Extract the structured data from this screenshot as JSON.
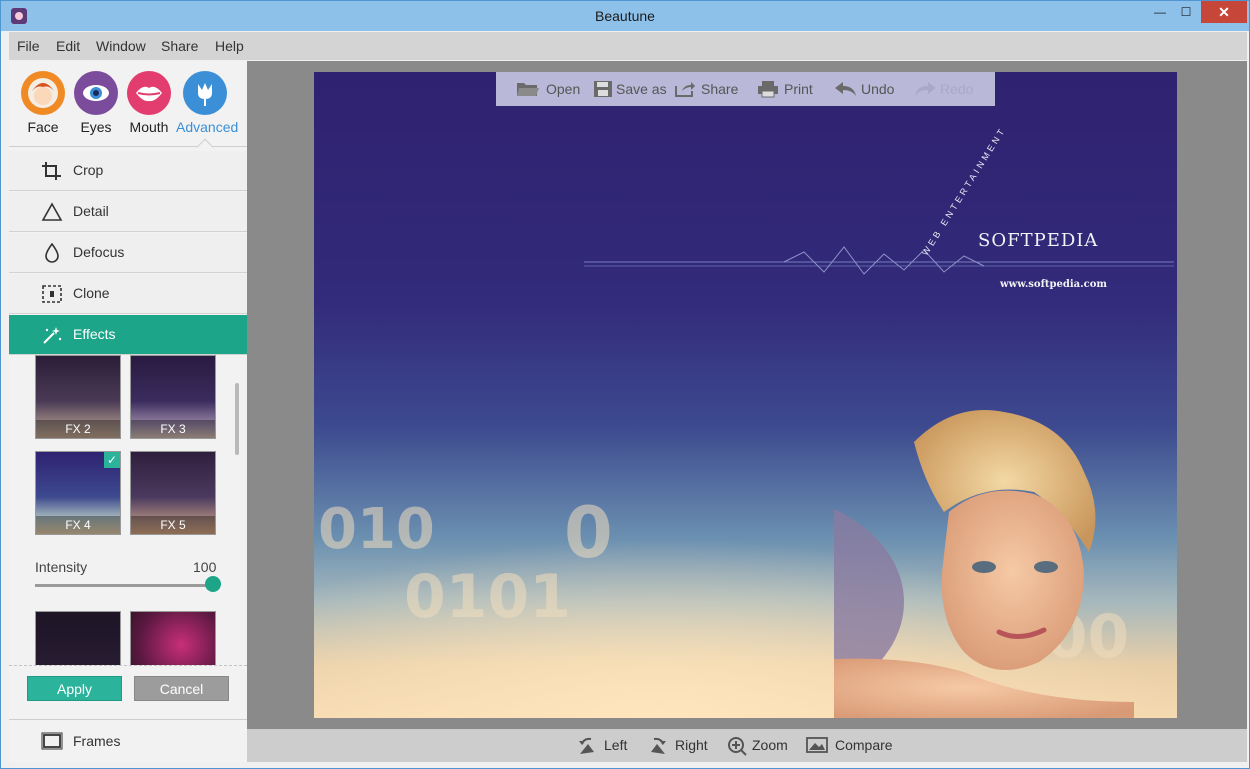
{
  "window": {
    "title": "Beautune",
    "minimize": "—",
    "maximize": "☐",
    "close": "✕"
  },
  "menu": [
    "File",
    "Edit",
    "Window",
    "Share",
    "Help"
  ],
  "categories": [
    {
      "label": "Face",
      "icon": "face-icon",
      "color": "#f08a24"
    },
    {
      "label": "Eyes",
      "icon": "eye-icon",
      "color": "#7b4c9c"
    },
    {
      "label": "Mouth",
      "icon": "mouth-icon",
      "color": "#e23d6e"
    },
    {
      "label": "Advanced",
      "icon": "flower-icon",
      "color": "#3a8fd6",
      "active": true
    }
  ],
  "tools": [
    {
      "label": "Crop",
      "icon": "crop-icon"
    },
    {
      "label": "Detail",
      "icon": "triangle-icon"
    },
    {
      "label": "Defocus",
      "icon": "droplet-icon"
    },
    {
      "label": "Clone",
      "icon": "clone-icon"
    },
    {
      "label": "Effects",
      "icon": "magic-wand-icon",
      "active": true
    }
  ],
  "effects": [
    {
      "label": "FX 2"
    },
    {
      "label": "FX 3"
    },
    {
      "label": "FX 4",
      "selected": true
    },
    {
      "label": "FX 5"
    }
  ],
  "intensity": {
    "label": "Intensity",
    "value": "100",
    "fraction": 1.0
  },
  "buttons": {
    "apply": "Apply",
    "cancel": "Cancel"
  },
  "frames": {
    "label": "Frames",
    "icon": "frame-icon"
  },
  "photo_toolbar": [
    {
      "label": "Open",
      "icon": "folder-icon"
    },
    {
      "label": "Save as",
      "icon": "save-icon"
    },
    {
      "label": "Share",
      "icon": "share-icon"
    },
    {
      "label": "Print",
      "icon": "printer-icon"
    },
    {
      "label": "Undo",
      "icon": "undo-icon"
    },
    {
      "label": "Redo",
      "icon": "redo-icon",
      "disabled": true
    }
  ],
  "photo": {
    "brand": "SOFTPEDIA",
    "url": "www.softpedia.com",
    "tagline": "WEB ENTERTAINMENT"
  },
  "bottom_bar": [
    {
      "label": "Left",
      "icon": "rotate-left-icon"
    },
    {
      "label": "Right",
      "icon": "rotate-right-icon"
    },
    {
      "label": "Zoom",
      "icon": "zoom-icon"
    },
    {
      "label": "Compare",
      "icon": "compare-icon"
    }
  ],
  "colors": {
    "accent": "#1da589",
    "apply": "#2bb39b",
    "cancel": "#9c9c9c",
    "photo_bg": "#322a7a"
  }
}
